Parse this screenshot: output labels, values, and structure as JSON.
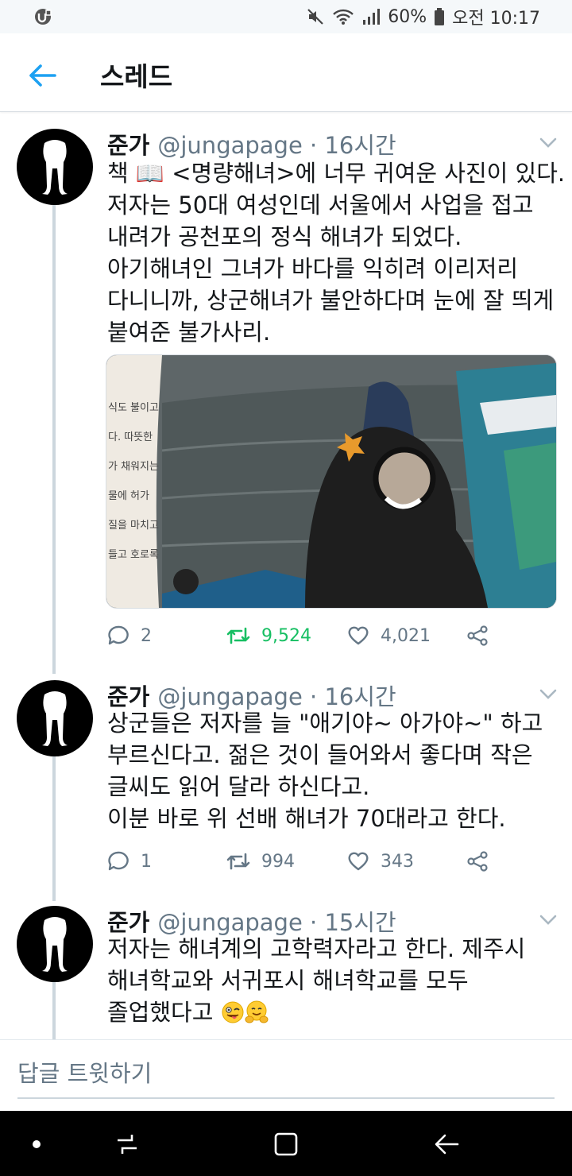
{
  "status_bar": {
    "battery": "60%",
    "time": "오전 10:17",
    "icons": [
      "app-notification-icon",
      "mute-icon",
      "wifi-icon",
      "signal-icon",
      "battery-icon"
    ]
  },
  "header": {
    "title": "스레드",
    "back_icon": "arrow-left-icon"
  },
  "colors": {
    "accent": "#1da1f2",
    "retweet_active": "#17bf63",
    "secondary_text": "#657786",
    "thread_line": "#ccd6dd"
  },
  "tweets": [
    {
      "name": "준가",
      "handle": "@jungapage",
      "time": "· 16시간",
      "lines": [
        "책 📖 <명량해녀>에 너무 귀여운 사진이 있다.",
        "저자는 50대 여성인데 서울에서 사업을 접고",
        "내려가 공천포의 정식 해녀가 되었다.",
        "아기해녀인 그녀가 바다를 익히려 이리저리",
        "다니니까, 상군해녀가 불안하다며 눈에 잘 띄게",
        "붙여준 불가사리."
      ],
      "image_book_text": [
        "식도 불이고,",
        "다. 따뜻한",
        "가 채워지는",
        "물에 허가",
        "질을 마치고",
        "들고 호로록"
      ],
      "replies": "2",
      "retweets": "9,524",
      "likes": "4,021"
    },
    {
      "name": "준가",
      "handle": "@jungapage",
      "time": "· 16시간",
      "lines": [
        "상군들은 저자를 늘 \"애기야~ 아가야~\" 하고",
        "부르신다고. 젊은 것이 들어와서 좋다며 작은",
        "글씨도 읽어 달라 하신다고.",
        "이분 바로 위 선배 해녀가 70대라고 한다."
      ],
      "replies": "1",
      "retweets": "994",
      "likes": "343"
    },
    {
      "name": "준가",
      "handle": "@jungapage",
      "time": "· 15시간",
      "lines": [
        "저자는 해녀계의 고학력자라고 한다. 제주시",
        "해녀학교와 서귀포시 해녀학교를 모두",
        "졸업했다고"
      ],
      "trailing_emoji": [
        "winking-tongue-face-icon",
        "hugging-face-icon"
      ]
    }
  ],
  "reply_placeholder": "답글 트윗하기",
  "nav_bar": {
    "icons": [
      "dot-icon",
      "recent-apps-icon",
      "home-square-icon",
      "back-arrow-icon"
    ]
  }
}
